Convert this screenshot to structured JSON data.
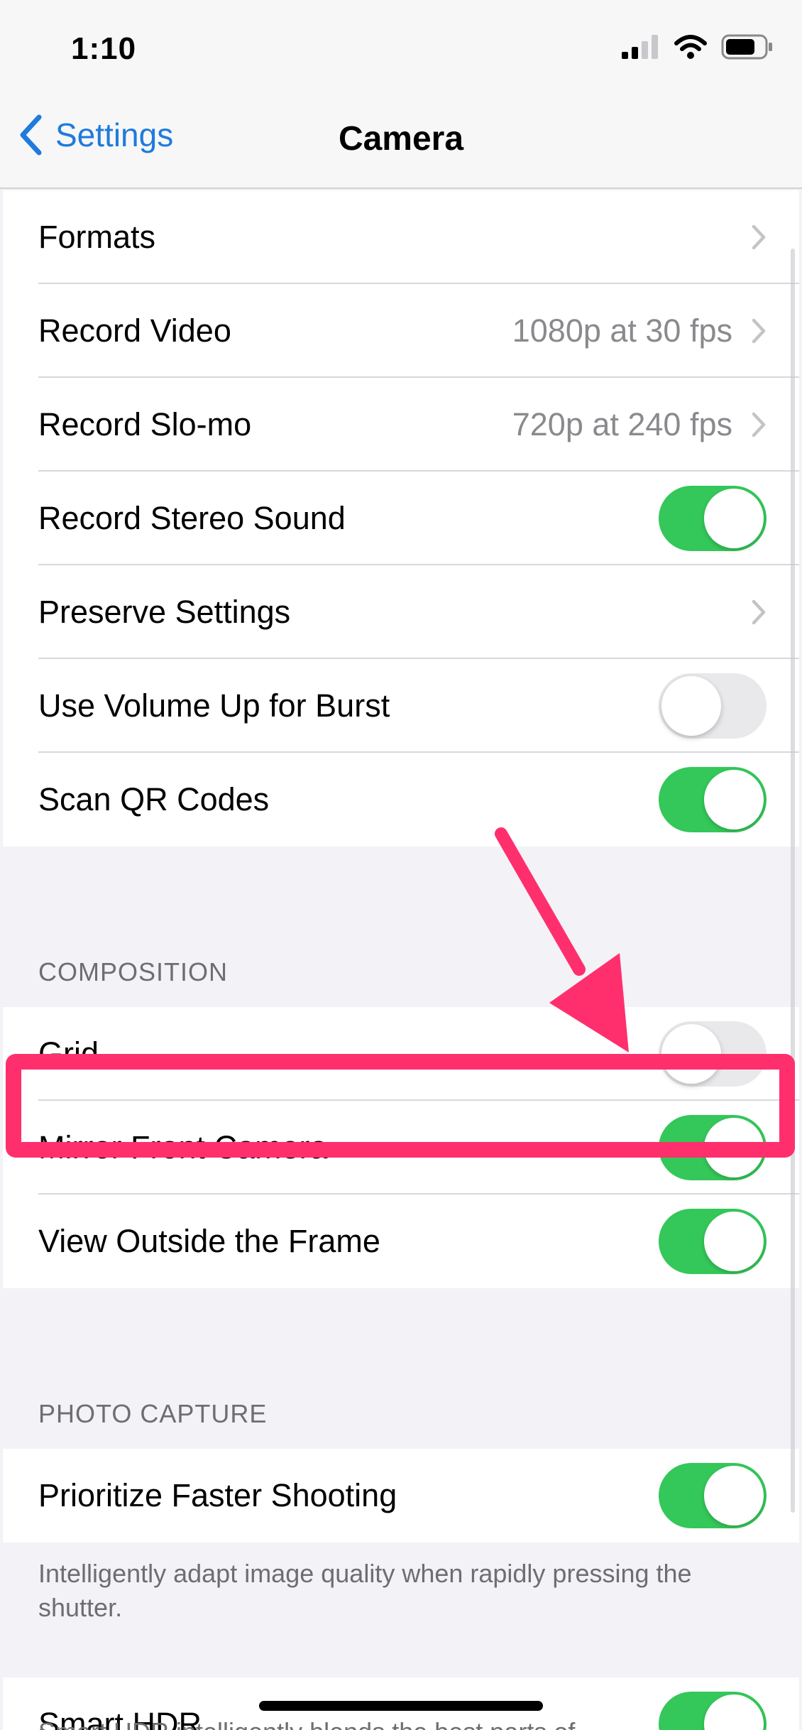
{
  "status_bar": {
    "time": "1:10",
    "signal_icon": "cellular-signal-icon",
    "wifi_icon": "wifi-icon",
    "battery_icon": "battery-icon"
  },
  "nav": {
    "back_label": "Settings",
    "title": "Camera"
  },
  "general_settings": [
    {
      "label": "Formats",
      "value": "",
      "control": "chevron"
    },
    {
      "label": "Record Video",
      "value": "1080p at 30 fps",
      "control": "chevron"
    },
    {
      "label": "Record Slo-mo",
      "value": "720p at 240 fps",
      "control": "chevron"
    },
    {
      "label": "Record Stereo Sound",
      "control": "toggle",
      "on": true
    },
    {
      "label": "Preserve Settings",
      "value": "",
      "control": "chevron"
    },
    {
      "label": "Use Volume Up for Burst",
      "control": "toggle",
      "on": false
    },
    {
      "label": "Scan QR Codes",
      "control": "toggle",
      "on": true
    }
  ],
  "composition": {
    "header": "COMPOSITION",
    "items": [
      {
        "label": "Grid",
        "on": false
      },
      {
        "label": "Mirror Front Camera",
        "on": true
      },
      {
        "label": "View Outside the Frame",
        "on": true
      }
    ]
  },
  "photo_capture": {
    "header": "PHOTO CAPTURE",
    "items": [
      {
        "label": "Prioritize Faster Shooting",
        "on": true
      }
    ],
    "footer": "Intelligently adapt image quality when rapidly pressing the shutter."
  },
  "hdr": {
    "items": [
      {
        "label": "Smart HDR",
        "on": true
      }
    ],
    "footer_partial": "Smart HDR intelligently blends the best parts of"
  },
  "colors": {
    "accent": "#1f7bdc",
    "toggle_on": "#34c759",
    "toggle_off": "#e9e9eb",
    "annotation": "#ff2f6e",
    "background": "#f2f2f7"
  }
}
